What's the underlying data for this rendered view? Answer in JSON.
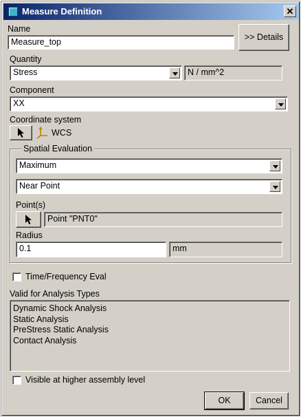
{
  "window": {
    "title": "Measure Definition",
    "close_glyph": "✕"
  },
  "name": {
    "label": "Name",
    "value": "Measure_top",
    "details_button": ">> Details"
  },
  "quantity": {
    "label": "Quantity",
    "selected": "Stress",
    "units": "N / mm^2"
  },
  "component": {
    "label": "Component",
    "selected": "XX"
  },
  "coordinate_system": {
    "label": "Coordinate system",
    "value": "WCS"
  },
  "spatial_evaluation": {
    "title": "Spatial Evaluation",
    "evaluation": "Maximum",
    "location": "Near Point",
    "points_label": "Point(s)",
    "points_value": "Point \"PNT0\"",
    "radius_label": "Radius",
    "radius_value": "0.1",
    "radius_units": "mm"
  },
  "time_frequency": {
    "label": "Time/Frequency Eval",
    "checked": false
  },
  "analysis_types": {
    "label": "Valid for Analysis Types",
    "items": [
      "Dynamic Shock Analysis",
      "Static Analysis",
      "PreStress Static Analysis",
      "Contact Analysis"
    ]
  },
  "visible_higher": {
    "label": "Visible at higher assembly level",
    "checked": false
  },
  "buttons": {
    "ok": "OK",
    "cancel": "Cancel"
  }
}
